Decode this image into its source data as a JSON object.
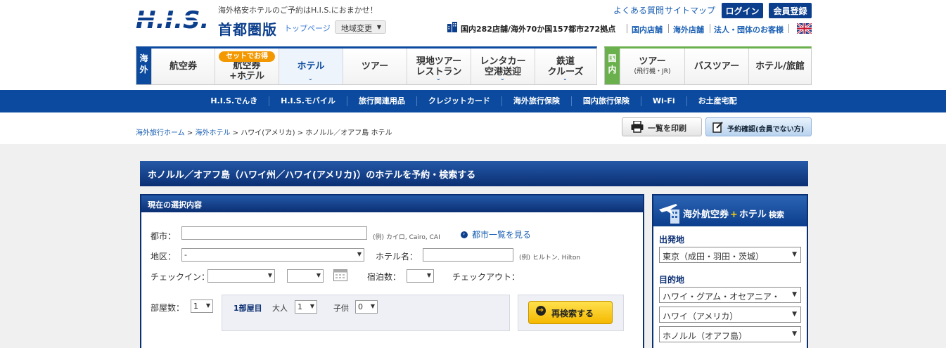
{
  "header": {
    "logo_text": "H.I.S.",
    "tagline": "海外格安ホテルのご予約はH.I.S.におまかせ！",
    "region": "首都圏版",
    "top_page": "トップページ",
    "area_change": "地域変更",
    "faq": "よくある質問",
    "sitemap": "サイトマップ",
    "login": "ログイン",
    "register": "会員登録",
    "store_count": "国内282店舗/海外70か国157都市272拠点",
    "links": [
      "国内店舗",
      "海外店舗",
      "法人・団体のお客様"
    ]
  },
  "nav_overseas": {
    "tag": "海外",
    "items": [
      {
        "label": "航空券",
        "badge": "",
        "active": false,
        "chevron": false
      },
      {
        "label": "航空券\n+ホテル",
        "badge": "セットでお得",
        "active": false,
        "chevron": true
      },
      {
        "label": "ホテル",
        "badge": "",
        "active": true,
        "chevron": true
      },
      {
        "label": "ツアー",
        "badge": "",
        "active": false,
        "chevron": false
      },
      {
        "label": "現地ツアー\nレストラン",
        "badge": "",
        "active": false,
        "chevron": true
      },
      {
        "label": "レンタカー\n空港送迎",
        "badge": "",
        "active": false,
        "chevron": true
      },
      {
        "label": "鉄道\nクルーズ",
        "badge": "",
        "active": false,
        "chevron": true
      }
    ]
  },
  "nav_domestic": {
    "tag": "国内",
    "items": [
      {
        "label": "ツアー",
        "sub": "(飛行機・JR)"
      },
      {
        "label": "バスツアー",
        "sub": ""
      },
      {
        "label": "ホテル/旅館",
        "sub": ""
      }
    ]
  },
  "sub_nav": [
    "H.I.S.でんき",
    "H.I.S.モバイル",
    "旅行関連用品",
    "クレジットカード",
    "海外旅行保険",
    "国内旅行保険",
    "Wi-Fi",
    "お土産宅配"
  ],
  "breadcrumb": [
    "海外旅行ホーム",
    "海外ホテル",
    "ハワイ(アメリカ)",
    "ホノルル／オアフ島 ホテル"
  ],
  "actions": {
    "print": "一覧を印刷",
    "confirm": "予約確認(会員でない方)"
  },
  "page_title": "ホノルル／オアフ島（ハワイ州／ハワイ(アメリカ)）のホテルを予約・検索する",
  "search_form": {
    "header": "現在の選択内容",
    "city_label": "都市：",
    "city_value": "",
    "city_example": "(例) カイロ, Cairo, CAI",
    "city_list_link": "都市一覧を見る",
    "district_label": "地区：",
    "district_value": "-",
    "hotel_label": "ホテル名：",
    "hotel_value": "",
    "hotel_example": "(例) ヒルトン, Hilton",
    "checkin_label": "チェックイン：",
    "checkin_month": "",
    "checkin_day": "",
    "nights_label": "宿泊数：",
    "nights_value": "",
    "checkout_label": "チェックアウト：",
    "rooms_label": "部屋数：",
    "rooms_value": "1",
    "room1_label": "1部屋目",
    "adults_label": "大人",
    "adults_value": "1",
    "children_label": "子供",
    "children_value": "0",
    "search_button": "再検索する"
  },
  "side_search": {
    "title_a": "海外航空券",
    "title_plus": "+",
    "title_b": "ホテル",
    "title_c": "検索",
    "departure_label": "出発地",
    "departure_value": "東京（成田・羽田・茨城）",
    "destination_label": "目的地",
    "dest_region": "ハワイ・グアム・オセアニア・",
    "dest_country": "ハワイ（アメリカ）",
    "dest_city": "ホノルル（オアフ島）"
  },
  "colors": {
    "brand_blue": "#0b4a9e",
    "domestic_green": "#6ab04c",
    "badge_orange": "#f39800",
    "search_yellow": "#f5b800"
  }
}
